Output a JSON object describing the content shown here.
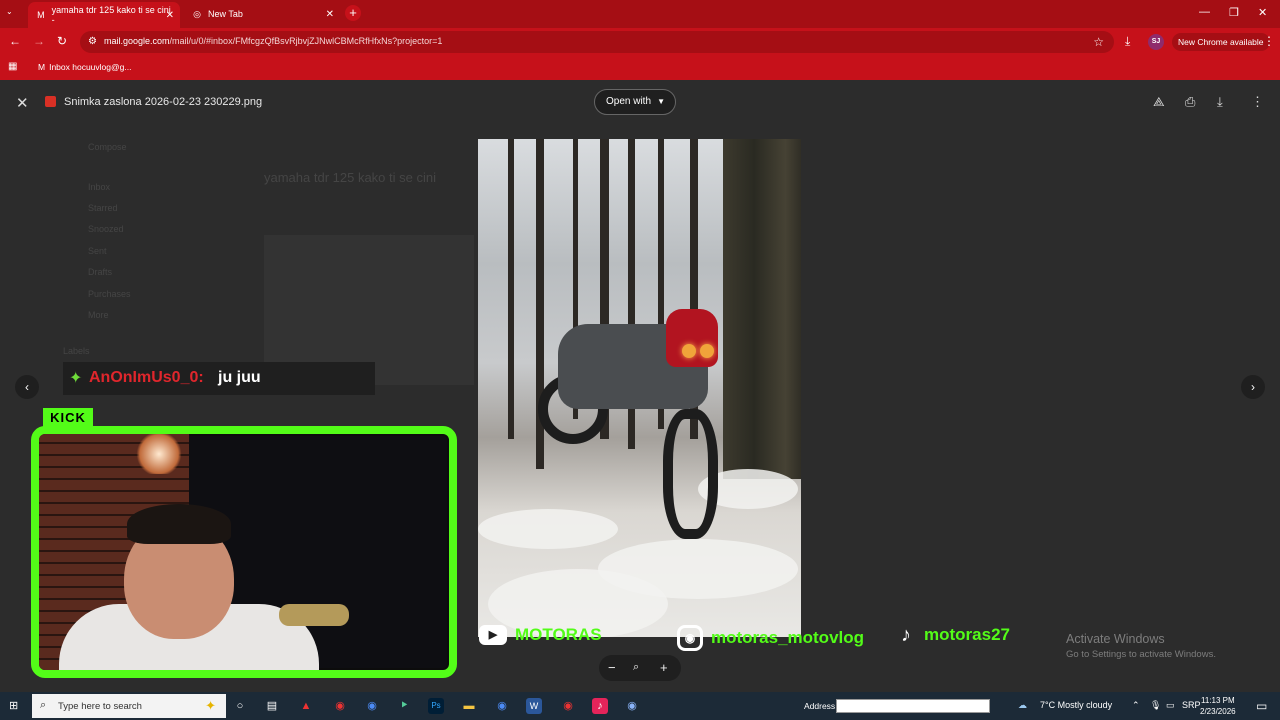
{
  "browser": {
    "tabs": [
      {
        "title": "yamaha tdr 125 kako ti se cini -",
        "active": true,
        "icon": "gmail-icon"
      },
      {
        "title": "New Tab",
        "active": false,
        "icon": "globe-icon"
      }
    ],
    "url_domain": "mail.google.com",
    "url_path": "/mail/u/0/#inbox/FMfcgzQfBsvRjbvjZJNwlCBMcRfHfxNs?projector=1",
    "new_chrome_label": "New Chrome available",
    "profile_initials": "SJ",
    "bookmark": "Inbox hocuuvlog@g...",
    "theme_color": "#c6111a"
  },
  "viewer": {
    "file_name": "Snimka zaslona 2026-02-23 230229.png",
    "open_with_label": "Open with"
  },
  "background_mail": {
    "subject": "yamaha tdr 125 kako ti se cini",
    "compose": "Compose",
    "folders": [
      "Inbox",
      "Starred",
      "Snoozed",
      "Sent",
      "Drafts",
      "Purchases",
      "More"
    ],
    "labels_heading": "Labels"
  },
  "overlay": {
    "chat_user": "AnOnImUs0_0:",
    "chat_message": "ju juu",
    "kick_badge": "KICK",
    "youtube": "MOTORAS",
    "instagram": "motoras_motovlog",
    "tiktok": "motoras27",
    "accent_color": "#53fc18"
  },
  "watermark": {
    "title": "Activate Windows",
    "subtitle": "Go to Settings to activate Windows."
  },
  "taskbar": {
    "search_placeholder": "Type here to search",
    "address_label": "Address",
    "weather": "7°C  Mostly cloudy",
    "language": "SRP",
    "time": "11:13 PM",
    "date": "2/23/2026"
  }
}
